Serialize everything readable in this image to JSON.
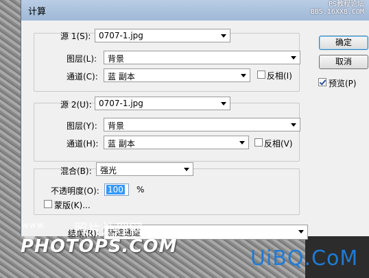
{
  "window": {
    "title": "计算",
    "watermark_line1": "PS教程论坛",
    "watermark_line2": "BBS.16XX8.COM"
  },
  "source1": {
    "label": "源 1(S):",
    "file": "0707-1.jpg",
    "layer_label": "图层(L):",
    "layer": "背景",
    "channel_label": "通道(C):",
    "channel": "蓝 副本",
    "invert_label": "反相(I)",
    "invert": false
  },
  "source2": {
    "label": "源 2(U):",
    "file": "0707-1.jpg",
    "layer_label": "图层(Y):",
    "layer": "背景",
    "channel_label": "通道(H):",
    "channel": "蓝 副本",
    "invert_label": "反相(V)",
    "invert": false
  },
  "blend": {
    "label": "混合(B):",
    "mode": "强光",
    "opacity_label": "不透明度(O):",
    "opacity": "100",
    "opacity_unit": "%",
    "mask_label": "蒙版(K)..."
  },
  "result": {
    "label": "结果(R):",
    "value": "新建通道"
  },
  "buttons": {
    "ok": "确定",
    "cancel": "取消",
    "preview_label": "预览(P)",
    "preview": true
  },
  "overlay": {
    "small_text": "www.",
    "mid_text": "照片处理网",
    "brand_text": "PHOTOPS.COM",
    "site_logo": "UiBQ.CoM"
  },
  "colors": {
    "title_bar": "#9fb8d6",
    "selection": "#3399ff",
    "logo_blue": "#1e7bd8"
  }
}
